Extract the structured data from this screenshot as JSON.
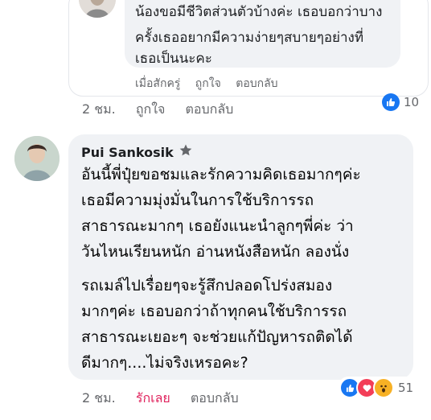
{
  "reply": {
    "text_lines": [
      "น้องขอมีชีวิตส่วนตัวบ้างค่ะ เธอบอกว่าบาง",
      "ครั้งเธออยากมีความง่ายๆสบายๆอย่างที่",
      "เธอเป็นนะคะ"
    ],
    "actions": [
      "เมื่อสักครู่",
      "ถูกใจ",
      "ตอบกลับ"
    ]
  },
  "parent_comment_actions": {
    "time": "2 ชม.",
    "like": "ถูกใจ",
    "reply": "ตอบกลับ",
    "reaction_count": "10",
    "reaction_icon": "like-icon"
  },
  "comment": {
    "author": "Pui Sankosik",
    "author_badge_icon": "star-badge-icon",
    "text_lines": [
      "อันนี้พี่ปุ๋ยขอชมและรักความคิดเธอมากๆค่ะ",
      "เธอมีความมุ่งมั่นในการใช้บริการรถ",
      "สาธารณะมากๆ เธอยังแนะนำลูกๆพี่ค่ะ ว่า",
      "วันไหนเรียนหนัก อ่านหนังสือหนัก ลองนั่ง",
      "รถเมล์ไปเรื่อยๆจะรู้สึกปลอดโปร่งสมอง",
      "มากๆค่ะ เธอบอกว่าถ้าทุกคนใช้บริการรถ",
      "สาธารณะเยอะๆ จะช่วยแก้ปัญหารถติดได้",
      "ดีมากๆ....ไม่จริงเหรอคะ?"
    ],
    "actions": {
      "time": "2 ชม.",
      "reaction": "รักเลย",
      "reply": "ตอบกลับ"
    },
    "reaction_count": "51",
    "reaction_icons": [
      "like-icon",
      "love-icon",
      "wow-icon"
    ],
    "colors": {
      "love_text": "#e0245e",
      "like": "#1877f2",
      "love": "#f33e58",
      "wow": "#f7b125"
    }
  }
}
